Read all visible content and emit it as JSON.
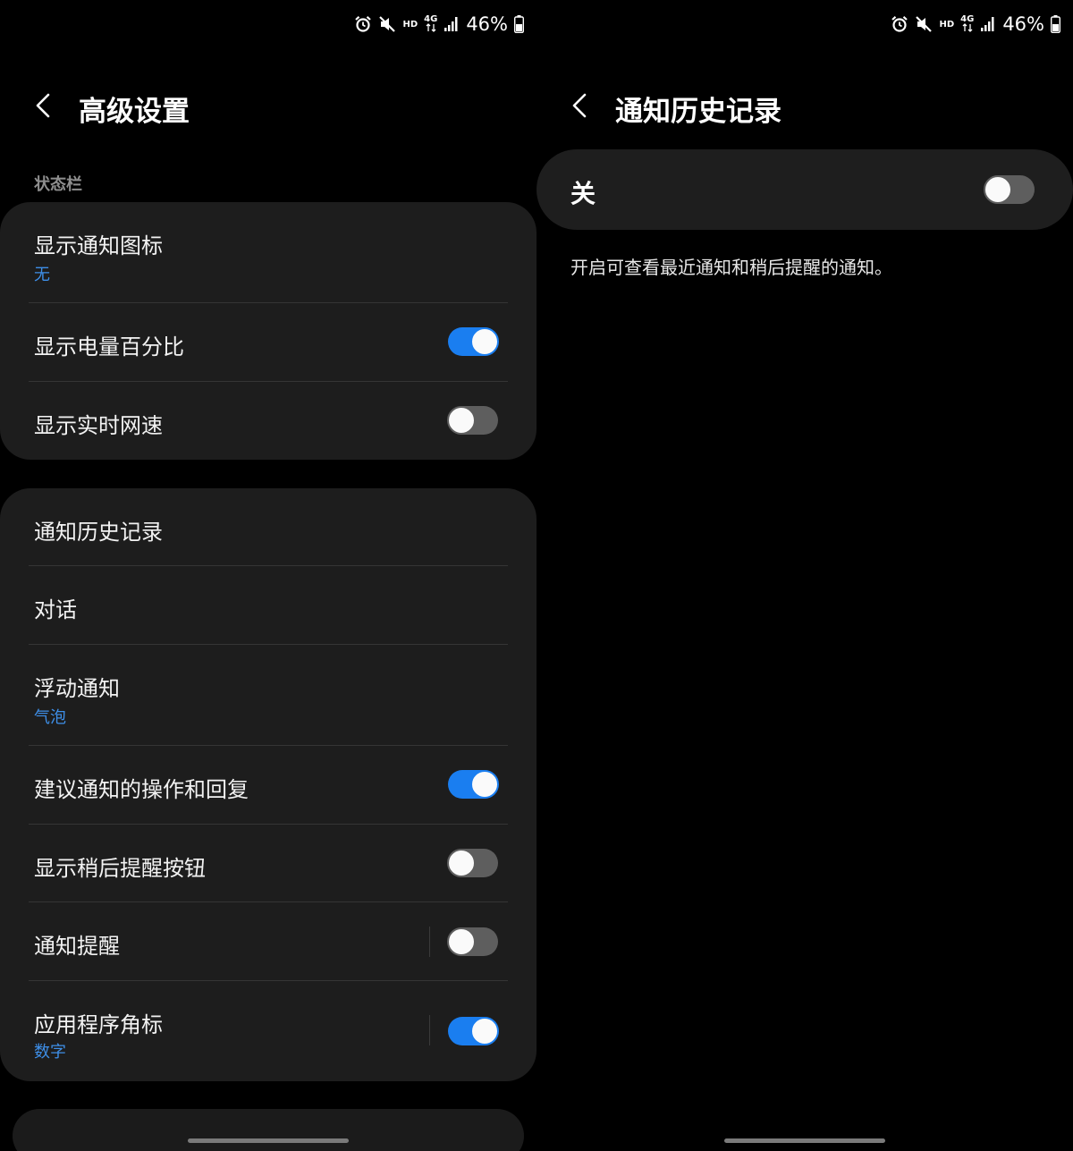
{
  "status_bar": {
    "battery_text": "46%",
    "network_badge": "HD",
    "network_type": "4G"
  },
  "left_screen": {
    "title": "高级设置",
    "section_label": "状态栏",
    "status_card": [
      {
        "title": "显示通知图标",
        "subtitle": "无"
      },
      {
        "title": "显示电量百分比",
        "toggle": true
      },
      {
        "title": "显示实时网速",
        "toggle": false
      }
    ],
    "notification_card": [
      {
        "title": "通知历史记录"
      },
      {
        "title": "对话"
      },
      {
        "title": "浮动通知",
        "subtitle": "气泡"
      },
      {
        "title": "建议通知的操作和回复",
        "toggle": true
      },
      {
        "title": "显示稍后提醒按钮",
        "toggle": false
      },
      {
        "title": "通知提醒",
        "toggle": false
      },
      {
        "title": "应用程序角标",
        "subtitle": "数字",
        "toggle": true
      }
    ]
  },
  "right_screen": {
    "title": "通知历史记录",
    "master_switch": {
      "label": "关",
      "toggle": false
    },
    "description": "开启可查看最近通知和稍后提醒的通知。"
  },
  "colors": {
    "accent": "#1a7ef0",
    "subtitle": "#3e8fe8",
    "card": "#1d1d1d",
    "background": "#000000"
  },
  "icons": [
    "alarm-icon",
    "mute-icon",
    "signal-icon",
    "battery-icon",
    "back-icon"
  ]
}
